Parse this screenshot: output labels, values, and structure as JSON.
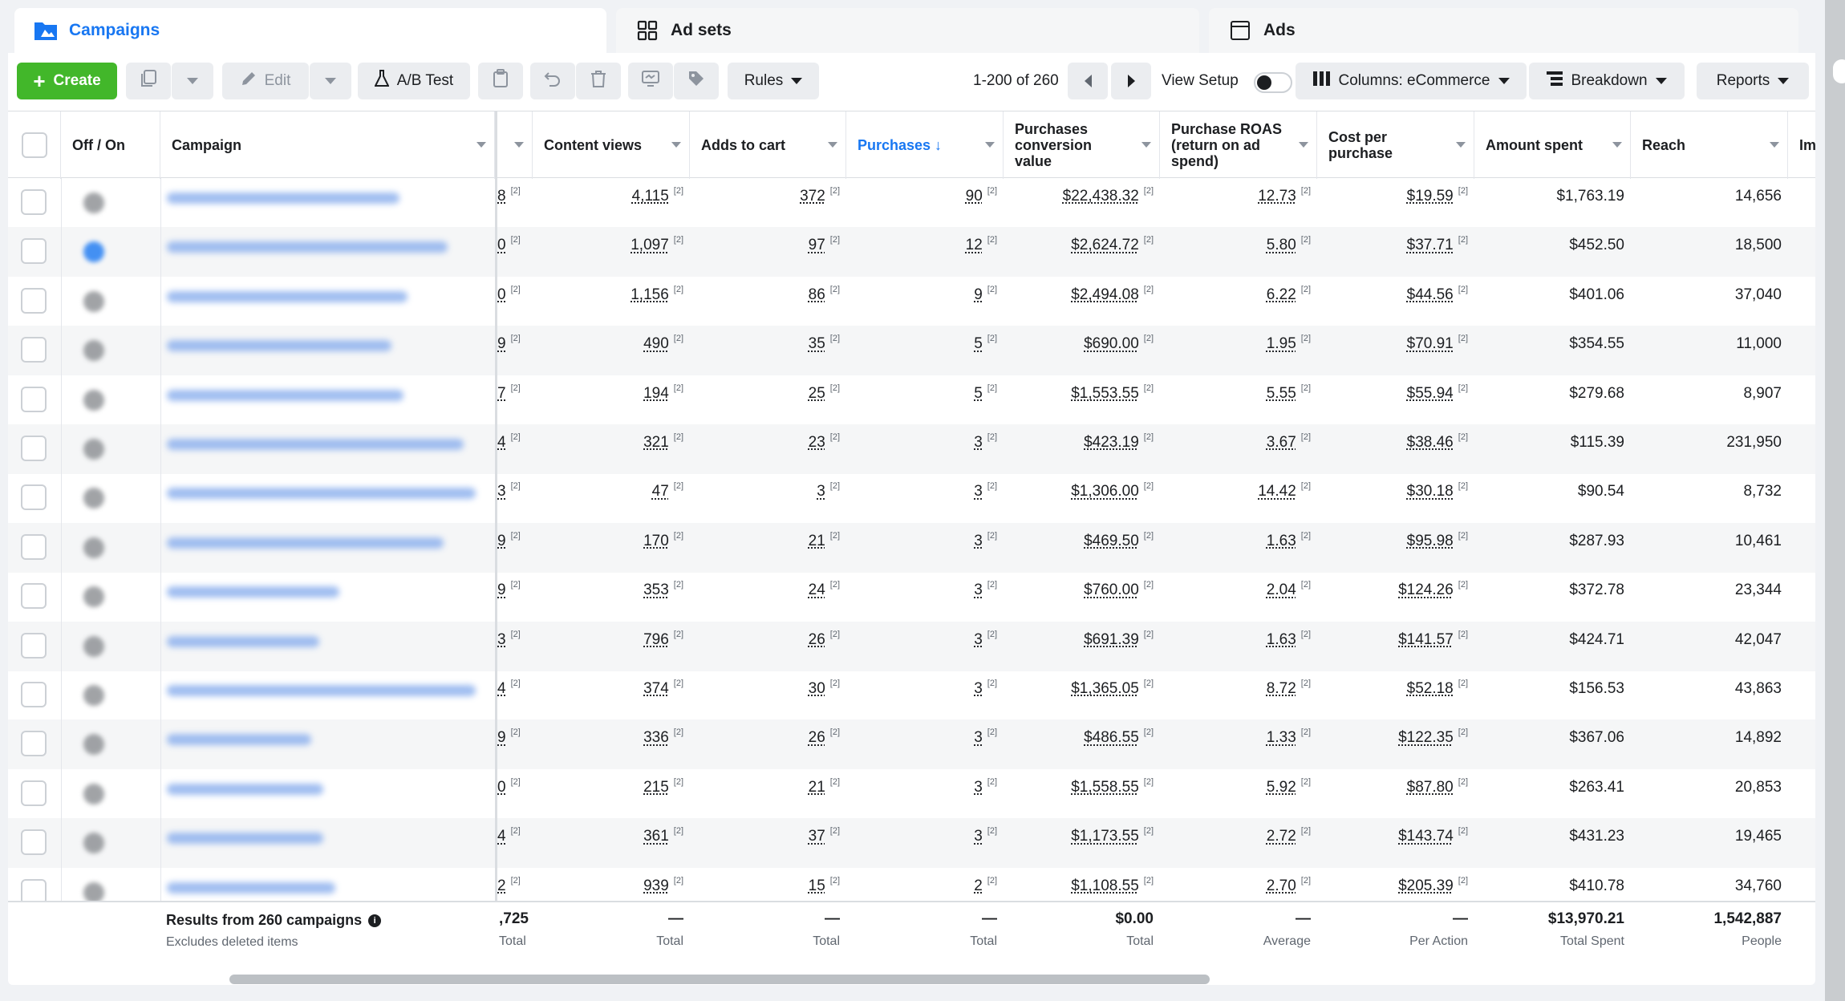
{
  "tabs": [
    {
      "label": "Campaigns",
      "icon": "folder-flag-icon",
      "active": true
    },
    {
      "label": "Ad sets",
      "icon": "grid-icon",
      "active": false
    },
    {
      "label": "Ads",
      "icon": "ad-page-icon",
      "active": false
    }
  ],
  "toolbar": {
    "create_label": "Create",
    "edit_label": "Edit",
    "ab_test_label": "A/B Test",
    "rules_label": "Rules",
    "pagination": "1-200 of 260",
    "view_setup_label": "View Setup",
    "columns_label": "Columns: eCommerce",
    "breakdown_label": "Breakdown",
    "reports_label": "Reports"
  },
  "columns": {
    "off_on": "Off / On",
    "campaign": "Campaign",
    "content_views": "Content views",
    "adds_to_cart": "Adds to cart",
    "purchases": "Purchases ↓",
    "conv_value": "Purchases conversion value",
    "roas": "Purchase ROAS (return on ad spend)",
    "cpp": "Cost per purchase",
    "amount_spent": "Amount spent",
    "reach": "Reach",
    "impressions_partial": "Im"
  },
  "rows": [
    {
      "prev": "8",
      "content_views": "4,115",
      "adds_to_cart": "372",
      "purchases": "90",
      "conv_value": "$22,438.32",
      "roas": "12.73",
      "cpp": "$19.59",
      "spent": "$1,763.19",
      "reach": "14,656"
    },
    {
      "prev": "0",
      "content_views": "1,097",
      "adds_to_cart": "97",
      "purchases": "12",
      "conv_value": "$2,624.72",
      "roas": "5.80",
      "cpp": "$37.71",
      "spent": "$452.50",
      "reach": "18,500"
    },
    {
      "prev": "0",
      "content_views": "1,156",
      "adds_to_cart": "86",
      "purchases": "9",
      "conv_value": "$2,494.08",
      "roas": "6.22",
      "cpp": "$44.56",
      "spent": "$401.06",
      "reach": "37,040"
    },
    {
      "prev": "9",
      "content_views": "490",
      "adds_to_cart": "35",
      "purchases": "5",
      "conv_value": "$690.00",
      "roas": "1.95",
      "cpp": "$70.91",
      "spent": "$354.55",
      "reach": "11,000"
    },
    {
      "prev": "7",
      "content_views": "194",
      "adds_to_cart": "25",
      "purchases": "5",
      "conv_value": "$1,553.55",
      "roas": "5.55",
      "cpp": "$55.94",
      "spent": "$279.68",
      "reach": "8,907"
    },
    {
      "prev": "4",
      "content_views": "321",
      "adds_to_cart": "23",
      "purchases": "3",
      "conv_value": "$423.19",
      "roas": "3.67",
      "cpp": "$38.46",
      "spent": "$115.39",
      "reach": "231,950"
    },
    {
      "prev": "3",
      "content_views": "47",
      "adds_to_cart": "3",
      "purchases": "3",
      "conv_value": "$1,306.00",
      "roas": "14.42",
      "cpp": "$30.18",
      "spent": "$90.54",
      "reach": "8,732"
    },
    {
      "prev": "9",
      "content_views": "170",
      "adds_to_cart": "21",
      "purchases": "3",
      "conv_value": "$469.50",
      "roas": "1.63",
      "cpp": "$95.98",
      "spent": "$287.93",
      "reach": "10,461"
    },
    {
      "prev": "9",
      "content_views": "353",
      "adds_to_cart": "24",
      "purchases": "3",
      "conv_value": "$760.00",
      "roas": "2.04",
      "cpp": "$124.26",
      "spent": "$372.78",
      "reach": "23,344"
    },
    {
      "prev": "3",
      "content_views": "796",
      "adds_to_cart": "26",
      "purchases": "3",
      "conv_value": "$691.39",
      "roas": "1.63",
      "cpp": "$141.57",
      "spent": "$424.71",
      "reach": "42,047"
    },
    {
      "prev": "4",
      "content_views": "374",
      "adds_to_cart": "30",
      "purchases": "3",
      "conv_value": "$1,365.05",
      "roas": "8.72",
      "cpp": "$52.18",
      "spent": "$156.53",
      "reach": "43,863"
    },
    {
      "prev": "9",
      "content_views": "336",
      "adds_to_cart": "26",
      "purchases": "3",
      "conv_value": "$486.55",
      "roas": "1.33",
      "cpp": "$122.35",
      "spent": "$367.06",
      "reach": "14,892"
    },
    {
      "prev": "0",
      "content_views": "215",
      "adds_to_cart": "21",
      "purchases": "3",
      "conv_value": "$1,558.55",
      "roas": "5.92",
      "cpp": "$87.80",
      "spent": "$263.41",
      "reach": "20,853"
    },
    {
      "prev": "4",
      "content_views": "361",
      "adds_to_cart": "37",
      "purchases": "3",
      "conv_value": "$1,173.55",
      "roas": "2.72",
      "cpp": "$143.74",
      "spent": "$431.23",
      "reach": "19,465"
    },
    {
      "prev": "2",
      "content_views": "939",
      "adds_to_cart": "15",
      "purchases": "2",
      "conv_value": "$1,108.55",
      "roas": "2.70",
      "cpp": "$205.39",
      "spent": "$410.78",
      "reach": "34,760"
    }
  ],
  "superscript": "[2]",
  "footer": {
    "results_title": "Results from 260 campaigns",
    "results_sub": "Excludes deleted items",
    "prev_value": ",725",
    "prev_label": "Total",
    "content_views_value": "—",
    "content_views_label": "Total",
    "adds_value": "—",
    "adds_label": "Total",
    "purchases_value": "—",
    "purchases_label": "Total",
    "conv_value_value": "$0.00",
    "conv_value_label": "Total",
    "roas_value": "—",
    "roas_label": "Average",
    "cpp_value": "—",
    "cpp_label": "Per Action",
    "spent_value": "$13,970.21",
    "spent_label": "Total Spent",
    "reach_value": "1,542,887",
    "reach_label": "People"
  }
}
